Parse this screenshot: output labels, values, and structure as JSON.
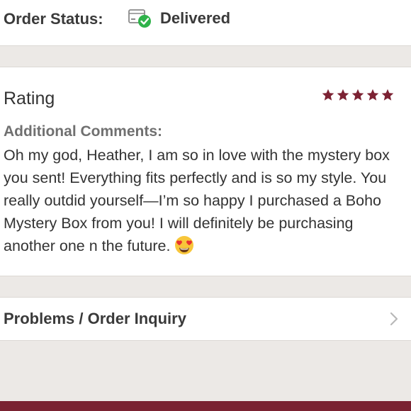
{
  "order_status": {
    "label": "Order Status:",
    "value": "Delivered",
    "icon": "package-delivered-icon"
  },
  "rating": {
    "title": "Rating",
    "stars": 5,
    "max_stars": 5,
    "star_color": "#7c2233"
  },
  "comments": {
    "label": "Additional Comments:",
    "text": "Oh my god, Heather, I am so in love with the mystery box you sent! Everything fits perfectly and is so my style. You really outdid yourself—I’m so happy I purchased a Boho Mystery Box from you! I will definitely be purchasing another one n the future.",
    "emoji": "heart-eyes-emoji"
  },
  "problems": {
    "label": "Problems / Order Inquiry",
    "icon": "chevron-right-icon"
  },
  "colors": {
    "background": "#ece9e6",
    "card": "#ffffff",
    "accent": "#7a2231",
    "delivered_green": "#2fb24a"
  }
}
